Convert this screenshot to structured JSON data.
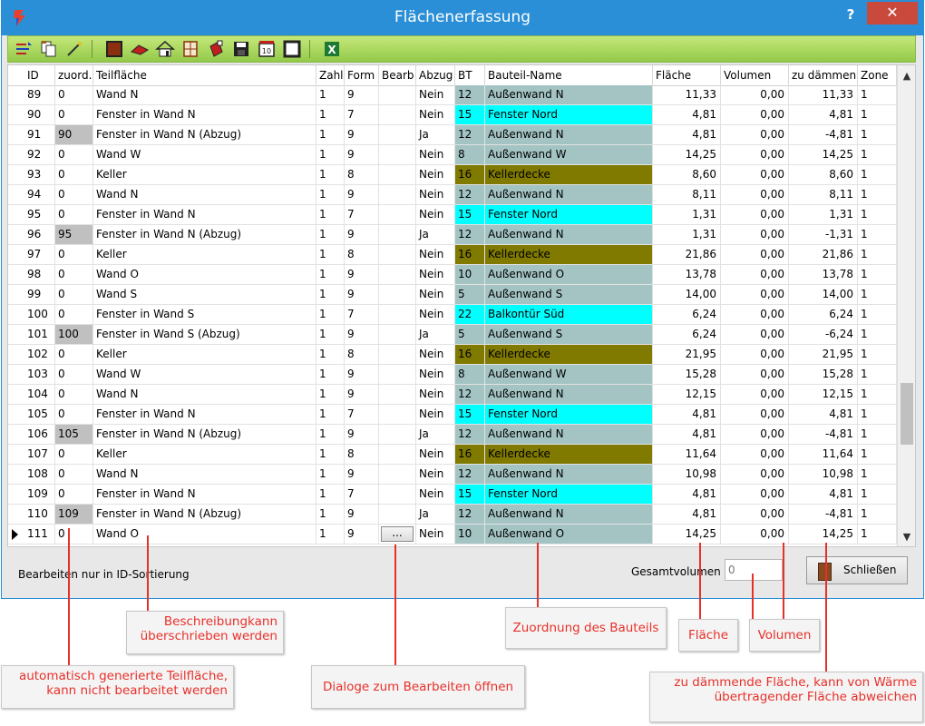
{
  "window": {
    "title": "Flächenerfassung",
    "help_label": "?",
    "close_label": "✕"
  },
  "toolbar": {
    "icons": [
      "sort-icon",
      "copy-icon",
      "edit-wand-icon",
      "wall-icon",
      "roof-icon",
      "house-icon",
      "window-icon",
      "paint-icon",
      "save-icon",
      "number-10-icon",
      "frame-icon",
      "excel-icon"
    ],
    "number_label": "10"
  },
  "columns": [
    "ID",
    "zuord.",
    "Teilfläche",
    "Zahl",
    "Form",
    "Bearb",
    "Abzug",
    "BT",
    "Bauteil-Name",
    "Fläche",
    "Volumen",
    "zu dämmen",
    "Zone"
  ],
  "colors": {
    "gray": "#c0c0c0",
    "wall": "#a4c4c4",
    "window": "#00ffff",
    "ceiling": "#807a00",
    "grid_border": "#e2e2e2",
    "accent_red": "#e8302a",
    "title_blue": "#2a8fd6"
  },
  "rows": [
    {
      "id": "89",
      "zuord": "0",
      "teil": "Wand N",
      "zahl": "1",
      "form": "9",
      "bearb": "",
      "abzug": "Nein",
      "bt": "12",
      "name": "Außenwand N",
      "flaeche": "11,33",
      "volumen": "0,00",
      "daemmen": "11,33",
      "zone": "1",
      "kind": "wall",
      "auto": false
    },
    {
      "id": "90",
      "zuord": "0",
      "teil": "Fenster in Wand N",
      "zahl": "1",
      "form": "7",
      "bearb": "",
      "abzug": "Nein",
      "bt": "15",
      "name": "Fenster Nord",
      "flaeche": "4,81",
      "volumen": "0,00",
      "daemmen": "4,81",
      "zone": "1",
      "kind": "window",
      "auto": false
    },
    {
      "id": "91",
      "zuord": "90",
      "teil": "Fenster in Wand N (Abzug)",
      "zahl": "1",
      "form": "9",
      "bearb": "",
      "abzug": "Ja",
      "bt": "12",
      "name": "Außenwand N",
      "flaeche": "4,81",
      "volumen": "0,00",
      "daemmen": "-4,81",
      "zone": "1",
      "kind": "wall",
      "auto": true
    },
    {
      "id": "92",
      "zuord": "0",
      "teil": "Wand W",
      "zahl": "1",
      "form": "9",
      "bearb": "",
      "abzug": "Nein",
      "bt": "8",
      "name": "Außenwand W",
      "flaeche": "14,25",
      "volumen": "0,00",
      "daemmen": "14,25",
      "zone": "1",
      "kind": "wall",
      "auto": false
    },
    {
      "id": "93",
      "zuord": "0",
      "teil": "Keller",
      "zahl": "1",
      "form": "8",
      "bearb": "",
      "abzug": "Nein",
      "bt": "16",
      "name": "Kellerdecke",
      "flaeche": "8,60",
      "volumen": "0,00",
      "daemmen": "8,60",
      "zone": "1",
      "kind": "ceiling",
      "auto": false
    },
    {
      "id": "94",
      "zuord": "0",
      "teil": "Wand N",
      "zahl": "1",
      "form": "9",
      "bearb": "",
      "abzug": "Nein",
      "bt": "12",
      "name": "Außenwand N",
      "flaeche": "8,11",
      "volumen": "0,00",
      "daemmen": "8,11",
      "zone": "1",
      "kind": "wall",
      "auto": false
    },
    {
      "id": "95",
      "zuord": "0",
      "teil": "Fenster in Wand N",
      "zahl": "1",
      "form": "7",
      "bearb": "",
      "abzug": "Nein",
      "bt": "15",
      "name": "Fenster Nord",
      "flaeche": "1,31",
      "volumen": "0,00",
      "daemmen": "1,31",
      "zone": "1",
      "kind": "window",
      "auto": false
    },
    {
      "id": "96",
      "zuord": "95",
      "teil": "Fenster in Wand N (Abzug)",
      "zahl": "1",
      "form": "9",
      "bearb": "",
      "abzug": "Ja",
      "bt": "12",
      "name": "Außenwand N",
      "flaeche": "1,31",
      "volumen": "0,00",
      "daemmen": "-1,31",
      "zone": "1",
      "kind": "wall",
      "auto": true
    },
    {
      "id": "97",
      "zuord": "0",
      "teil": "Keller",
      "zahl": "1",
      "form": "8",
      "bearb": "",
      "abzug": "Nein",
      "bt": "16",
      "name": "Kellerdecke",
      "flaeche": "21,86",
      "volumen": "0,00",
      "daemmen": "21,86",
      "zone": "1",
      "kind": "ceiling",
      "auto": false
    },
    {
      "id": "98",
      "zuord": "0",
      "teil": "Wand O",
      "zahl": "1",
      "form": "9",
      "bearb": "",
      "abzug": "Nein",
      "bt": "10",
      "name": "Außenwand O",
      "flaeche": "13,78",
      "volumen": "0,00",
      "daemmen": "13,78",
      "zone": "1",
      "kind": "wall",
      "auto": false
    },
    {
      "id": "99",
      "zuord": "0",
      "teil": "Wand S",
      "zahl": "1",
      "form": "9",
      "bearb": "",
      "abzug": "Nein",
      "bt": "5",
      "name": "Außenwand S",
      "flaeche": "14,00",
      "volumen": "0,00",
      "daemmen": "14,00",
      "zone": "1",
      "kind": "wall",
      "auto": false
    },
    {
      "id": "100",
      "zuord": "0",
      "teil": "Fenster in Wand S",
      "zahl": "1",
      "form": "7",
      "bearb": "",
      "abzug": "Nein",
      "bt": "22",
      "name": "Balkontür Süd",
      "flaeche": "6,24",
      "volumen": "0,00",
      "daemmen": "6,24",
      "zone": "1",
      "kind": "window",
      "auto": false
    },
    {
      "id": "101",
      "zuord": "100",
      "teil": "Fenster in Wand S (Abzug)",
      "zahl": "1",
      "form": "9",
      "bearb": "",
      "abzug": "Ja",
      "bt": "5",
      "name": "Außenwand S",
      "flaeche": "6,24",
      "volumen": "0,00",
      "daemmen": "-6,24",
      "zone": "1",
      "kind": "wall",
      "auto": true
    },
    {
      "id": "102",
      "zuord": "0",
      "teil": "Keller",
      "zahl": "1",
      "form": "8",
      "bearb": "",
      "abzug": "Nein",
      "bt": "16",
      "name": "Kellerdecke",
      "flaeche": "21,95",
      "volumen": "0,00",
      "daemmen": "21,95",
      "zone": "1",
      "kind": "ceiling",
      "auto": false
    },
    {
      "id": "103",
      "zuord": "0",
      "teil": "Wand W",
      "zahl": "1",
      "form": "9",
      "bearb": "",
      "abzug": "Nein",
      "bt": "8",
      "name": "Außenwand W",
      "flaeche": "15,28",
      "volumen": "0,00",
      "daemmen": "15,28",
      "zone": "1",
      "kind": "wall",
      "auto": false
    },
    {
      "id": "104",
      "zuord": "0",
      "teil": "Wand N",
      "zahl": "1",
      "form": "9",
      "bearb": "",
      "abzug": "Nein",
      "bt": "12",
      "name": "Außenwand N",
      "flaeche": "12,15",
      "volumen": "0,00",
      "daemmen": "12,15",
      "zone": "1",
      "kind": "wall",
      "auto": false
    },
    {
      "id": "105",
      "zuord": "0",
      "teil": "Fenster in Wand N",
      "zahl": "1",
      "form": "7",
      "bearb": "",
      "abzug": "Nein",
      "bt": "15",
      "name": "Fenster Nord",
      "flaeche": "4,81",
      "volumen": "0,00",
      "daemmen": "4,81",
      "zone": "1",
      "kind": "window",
      "auto": false
    },
    {
      "id": "106",
      "zuord": "105",
      "teil": "Fenster in Wand N (Abzug)",
      "zahl": "1",
      "form": "9",
      "bearb": "",
      "abzug": "Ja",
      "bt": "12",
      "name": "Außenwand N",
      "flaeche": "4,81",
      "volumen": "0,00",
      "daemmen": "-4,81",
      "zone": "1",
      "kind": "wall",
      "auto": true
    },
    {
      "id": "107",
      "zuord": "0",
      "teil": "Keller",
      "zahl": "1",
      "form": "8",
      "bearb": "",
      "abzug": "Nein",
      "bt": "16",
      "name": "Kellerdecke",
      "flaeche": "11,64",
      "volumen": "0,00",
      "daemmen": "11,64",
      "zone": "1",
      "kind": "ceiling",
      "auto": false
    },
    {
      "id": "108",
      "zuord": "0",
      "teil": "Wand N",
      "zahl": "1",
      "form": "9",
      "bearb": "",
      "abzug": "Nein",
      "bt": "12",
      "name": "Außenwand N",
      "flaeche": "10,98",
      "volumen": "0,00",
      "daemmen": "10,98",
      "zone": "1",
      "kind": "wall",
      "auto": false
    },
    {
      "id": "109",
      "zuord": "0",
      "teil": "Fenster in Wand N",
      "zahl": "1",
      "form": "7",
      "bearb": "",
      "abzug": "Nein",
      "bt": "15",
      "name": "Fenster Nord",
      "flaeche": "4,81",
      "volumen": "0,00",
      "daemmen": "4,81",
      "zone": "1",
      "kind": "window",
      "auto": false
    },
    {
      "id": "110",
      "zuord": "109",
      "teil": "Fenster in Wand N (Abzug)",
      "zahl": "1",
      "form": "9",
      "bearb": "",
      "abzug": "Ja",
      "bt": "12",
      "name": "Außenwand N",
      "flaeche": "4,81",
      "volumen": "0,00",
      "daemmen": "-4,81",
      "zone": "1",
      "kind": "wall",
      "auto": true
    },
    {
      "id": "111",
      "zuord": "0",
      "teil": "Wand O",
      "zahl": "1",
      "form": "9",
      "bearb": "...",
      "abzug": "Nein",
      "bt": "10",
      "name": "Außenwand O",
      "flaeche": "14,25",
      "volumen": "0,00",
      "daemmen": "14,25",
      "zone": "1",
      "kind": "wall",
      "auto": false,
      "current": true
    }
  ],
  "status": {
    "hint": "Bearbeiten nur in ID-Sortierung",
    "total_label": "Gesamtvolumen",
    "total_value": "0",
    "close_button": "Schließen"
  },
  "annotations": {
    "description": "Beschreibungkann\nüberschrieben werden",
    "auto_generated": "automatisch generierte Teilfläche,\nkann nicht bearbeitet werden",
    "dialogs": "Dialoge zum Bearbeiten öffnen",
    "assignment": "Zuordnung des Bauteils",
    "area": "Fläche",
    "volume": "Volumen",
    "insulate": "zu dämmende Fläche, kann von Wärme\nübertragender Fläche abweichen"
  }
}
